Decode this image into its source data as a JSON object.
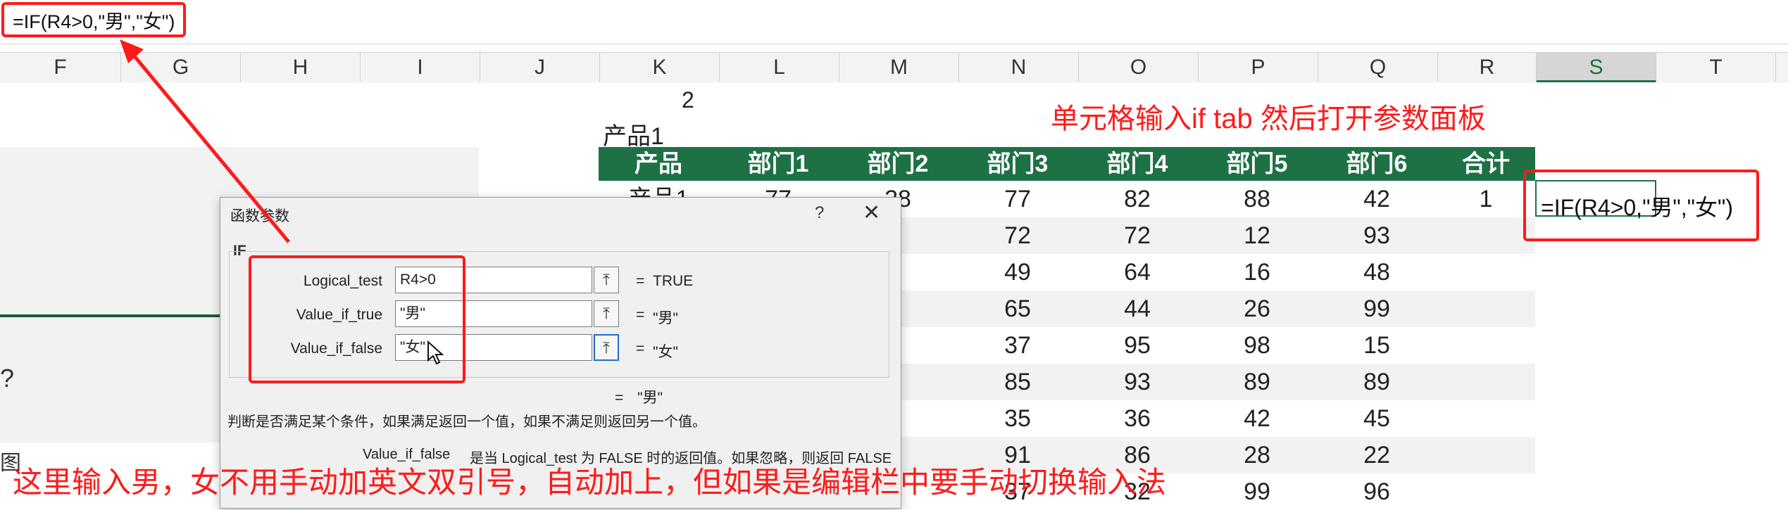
{
  "formula_bar": {
    "text": "=IF(R4>0,\"男\",\"女\")"
  },
  "columns": [
    "F",
    "G",
    "H",
    "I",
    "J",
    "K",
    "L",
    "M",
    "N",
    "O",
    "P",
    "Q",
    "R",
    "S",
    "T"
  ],
  "active_column": "S",
  "sheet": {
    "title_number": "2",
    "title_product": "产品1",
    "headers": [
      "产品",
      "部门1",
      "部门2",
      "部门3",
      "部门4",
      "部门5",
      "部门6",
      "合计"
    ],
    "rows": [
      [
        "产品1",
        "77",
        "28",
        "77",
        "82",
        "88",
        "42",
        "1"
      ],
      [
        "",
        "",
        "",
        "72",
        "72",
        "12",
        "93",
        ""
      ],
      [
        "",
        "",
        "",
        "49",
        "64",
        "16",
        "48",
        ""
      ],
      [
        "",
        "",
        "",
        "65",
        "44",
        "26",
        "99",
        ""
      ],
      [
        "",
        "",
        "",
        "37",
        "95",
        "98",
        "15",
        ""
      ],
      [
        "",
        "",
        "",
        "85",
        "93",
        "89",
        "89",
        ""
      ],
      [
        "",
        "",
        "",
        "35",
        "36",
        "42",
        "45",
        ""
      ],
      [
        "",
        "",
        "",
        "91",
        "86",
        "28",
        "22",
        ""
      ],
      [
        "",
        "",
        "",
        "37",
        "32",
        "99",
        "96",
        ""
      ]
    ],
    "left_question": "?",
    "left_stub": "图",
    "s_cell_formula": "=IF(R4>0,\"男\",\"女\")"
  },
  "annotations": {
    "top": "单元格输入if tab 然后打开参数面板",
    "bottom": "这里输入男，女不用手动加英文双引号，自动加上，但如果是编辑栏中要手动切换输入法"
  },
  "dialog": {
    "title": "函数参数",
    "help": "?",
    "close": "✕",
    "function_name": "IF",
    "args": [
      {
        "label": "Logical_test",
        "value": "R4>0",
        "result": "TRUE"
      },
      {
        "label": "Value_if_true",
        "value": "\"男\"",
        "result": "\"男\""
      },
      {
        "label": "Value_if_false",
        "value": "\"女\"",
        "result": "\"女\""
      }
    ],
    "equals": "=",
    "overall_result": "\"男\"",
    "description": "判断是否满足某个条件，如果满足返回一个值，如果不满足则返回另一个值。",
    "arg_desc_name": "Value_if_false",
    "arg_desc": "是当 Logical_test 为 FALSE 时的返回值。如果忽略，则返回 FALSE",
    "collapse_icon": "⤒"
  },
  "colors": {
    "accent_red": "#ff1a1a",
    "header_green": "#1e7145"
  }
}
